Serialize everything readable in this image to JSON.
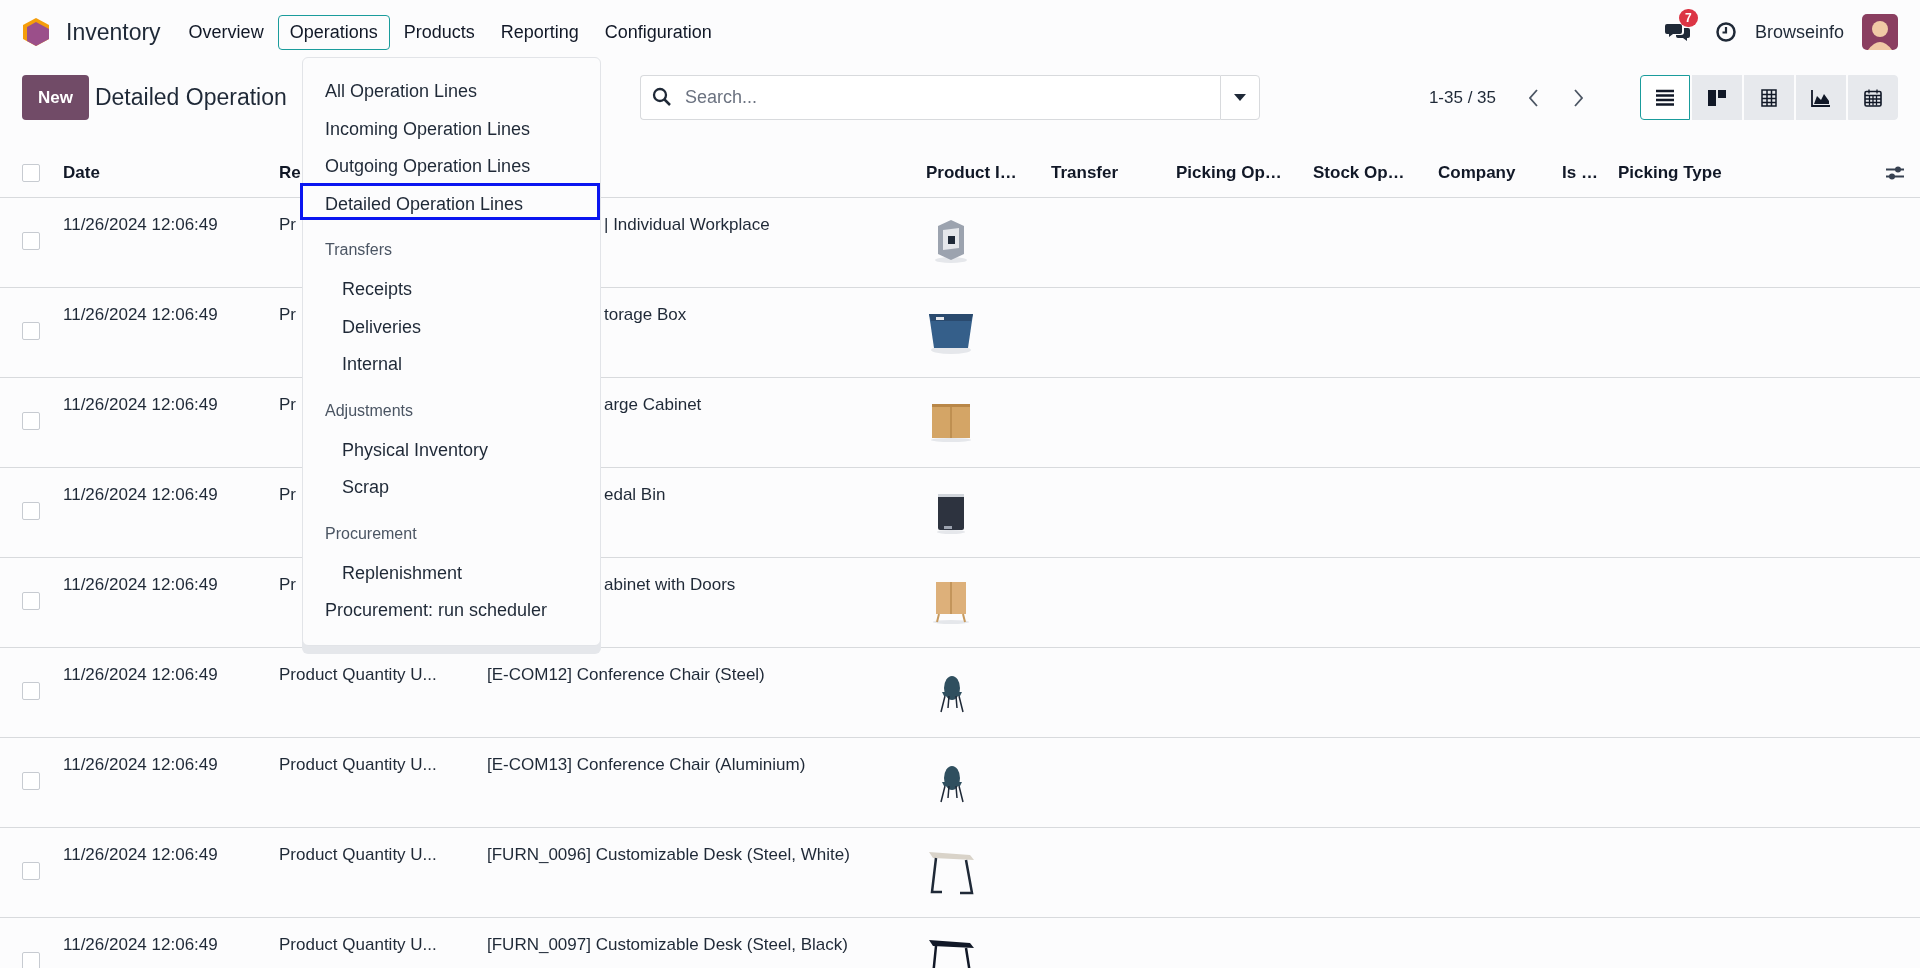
{
  "app": {
    "name": "Inventory"
  },
  "menu": [
    {
      "label": "Overview",
      "selected": false
    },
    {
      "label": "Operations",
      "selected": true
    },
    {
      "label": "Products",
      "selected": false
    },
    {
      "label": "Reporting",
      "selected": false
    },
    {
      "label": "Configuration",
      "selected": false
    }
  ],
  "systray": {
    "badge": "7",
    "user": "Browseinfo"
  },
  "control_panel": {
    "new_button": "New",
    "title": "Detailed Operation",
    "search": {
      "placeholder": "Search..."
    },
    "pager": "1-35 / 35",
    "views": [
      {
        "kind": "list",
        "selected": true
      },
      {
        "kind": "kanban",
        "selected": false
      },
      {
        "kind": "pivot",
        "selected": false
      },
      {
        "kind": "graph",
        "selected": false
      },
      {
        "kind": "calendar",
        "selected": false
      }
    ]
  },
  "dropdown": [
    {
      "kind": "item",
      "label": "All Operation Lines",
      "selected": false
    },
    {
      "kind": "item",
      "label": "Incoming Operation Lines",
      "selected": false
    },
    {
      "kind": "item",
      "label": "Outgoing Operation Lines",
      "selected": false
    },
    {
      "kind": "item",
      "label": "Detailed Operation Lines",
      "selected": true
    },
    {
      "kind": "header",
      "label": "Transfers"
    },
    {
      "kind": "subitem",
      "label": "Receipts",
      "selected": false
    },
    {
      "kind": "subitem",
      "label": "Deliveries",
      "selected": false
    },
    {
      "kind": "subitem",
      "label": "Internal",
      "selected": false
    },
    {
      "kind": "header",
      "label": "Adjustments"
    },
    {
      "kind": "subitem",
      "label": "Physical Inventory",
      "selected": false
    },
    {
      "kind": "subitem",
      "label": "Scrap",
      "selected": false
    },
    {
      "kind": "header",
      "label": "Procurement"
    },
    {
      "kind": "subitem",
      "label": "Replenishment",
      "selected": false
    },
    {
      "kind": "item",
      "label": "Procurement: run scheduler",
      "selected": false
    }
  ],
  "table": {
    "select_all": {
      "checked": false
    },
    "columns": [
      "Date",
      "Re",
      "Product I…",
      "Transfer",
      "Picking Op…",
      "Stock Op…",
      "Company",
      "Is …",
      "Picking Type"
    ],
    "rows": [
      {
        "kind": "covered",
        "checked": false,
        "date": "11/26/2024 12:06:49",
        "reference": "Pr",
        "product": "| Individual Workplace"
      },
      {
        "kind": "covered",
        "checked": false,
        "date": "11/26/2024 12:06:49",
        "reference": "Pr",
        "product": "torage Box"
      },
      {
        "kind": "covered",
        "checked": false,
        "date": "11/26/2024 12:06:49",
        "reference": "Pr",
        "product": "arge Cabinet"
      },
      {
        "kind": "covered",
        "checked": false,
        "date": "11/26/2024 12:06:49",
        "reference": "Pr",
        "product": "edal Bin"
      },
      {
        "kind": "covered",
        "checked": false,
        "date": "11/26/2024 12:06:49",
        "reference": "Pr",
        "product": "abinet with Doors"
      },
      {
        "kind": "full",
        "checked": false,
        "date": "11/26/2024 12:06:49",
        "reference": "Product Quantity U...",
        "product": "[E-COM12] Conference Chair (Steel)"
      },
      {
        "kind": "full",
        "checked": false,
        "date": "11/26/2024 12:06:49",
        "reference": "Product Quantity U...",
        "product": "[E-COM13] Conference Chair (Aluminium)"
      },
      {
        "kind": "full",
        "checked": false,
        "date": "11/26/2024 12:06:49",
        "reference": "Product Quantity U...",
        "product": "[FURN_0096] Customizable Desk (Steel, White)"
      },
      {
        "kind": "full",
        "checked": false,
        "date": "11/26/2024 12:06:49",
        "reference": "Product Quantity U...",
        "product": "[FURN_0097] Customizable Desk (Steel, Black)"
      }
    ]
  }
}
